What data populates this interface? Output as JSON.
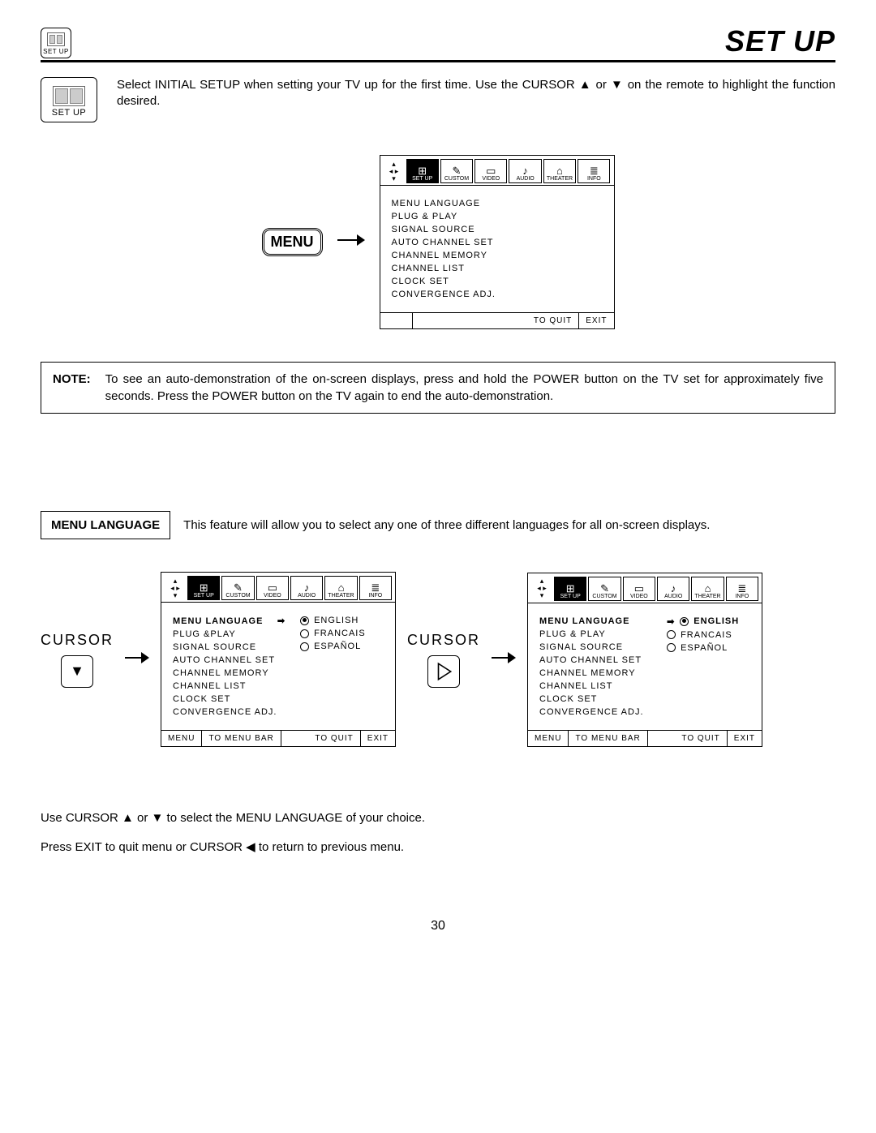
{
  "header": {
    "title": "SET UP",
    "icon_label": "SET UP"
  },
  "intro": {
    "icon_label": "SET UP",
    "text": "Select INITIAL SETUP when setting your TV up for the first time.  Use the CURSOR ▲ or ▼ on the remote to highlight the function desired."
  },
  "menu_button": "MENU",
  "osd_tabs": {
    "arrows": {
      "up": "▴",
      "left": "◂",
      "right": "▸",
      "down": "▾"
    },
    "items": [
      {
        "label": "SET UP",
        "active": true
      },
      {
        "label": "CUSTOM"
      },
      {
        "label": "VIDEO"
      },
      {
        "label": "AUDIO"
      },
      {
        "label": "THEATER"
      },
      {
        "label": "INFO"
      }
    ]
  },
  "osd_main": {
    "items": [
      "MENU LANGUAGE",
      "PLUG & PLAY",
      "SIGNAL SOURCE",
      "AUTO CHANNEL SET",
      "CHANNEL MEMORY",
      "CHANNEL LIST",
      "CLOCK SET",
      "CONVERGENCE ADJ."
    ],
    "footer_quit": "TO QUIT",
    "footer_exit": "EXIT"
  },
  "note": {
    "label": "NOTE:",
    "text": "To see an auto-demonstration of the on-screen displays, press and hold the POWER button on the TV set for approximately five seconds. Press the POWER button on the TV again to end the auto-demonstration."
  },
  "ml_head": {
    "box": "MENU LANGUAGE",
    "desc": "This feature will allow you to select any one of three different languages for all on-screen displays."
  },
  "cursor_label": "CURSOR",
  "osd_lang": {
    "items": [
      "MENU LANGUAGE",
      "PLUG &PLAY",
      "SIGNAL SOURCE",
      "AUTO CHANNEL SET",
      "CHANNEL MEMORY",
      "CHANNEL LIST",
      "CLOCK SET",
      "CONVERGENCE ADJ."
    ],
    "langs": [
      {
        "label": "ENGLISH",
        "selected": true
      },
      {
        "label": "FRANCAIS",
        "selected": false
      },
      {
        "label": "ESPAÑOL",
        "selected": false
      }
    ],
    "footer_menu": "MENU",
    "footer_bar": "TO MENU BAR",
    "footer_quit": "TO QUIT",
    "footer_exit": "EXIT"
  },
  "osd_lang2": {
    "items": [
      "MENU LANGUAGE",
      "PLUG & PLAY",
      "SIGNAL SOURCE",
      "AUTO CHANNEL SET",
      "CHANNEL MEMORY",
      "CHANNEL LIST",
      "CLOCK SET",
      "CONVERGENCE ADJ."
    ],
    "langs": [
      {
        "label": "ENGLISH",
        "selected": true,
        "bold": true
      },
      {
        "label": "FRANCAIS",
        "selected": false
      },
      {
        "label": "ESPAÑOL",
        "selected": false
      }
    ],
    "footer_menu": "MENU",
    "footer_bar": "TO MENU BAR",
    "footer_quit": "TO QUIT",
    "footer_exit": "EXIT"
  },
  "instructions": {
    "l1": "Use CURSOR ▲ or ▼ to select the MENU LANGUAGE of your choice.",
    "l2": "Press EXIT to quit menu or CURSOR ◀ to return to previous menu."
  },
  "page_number": "30"
}
